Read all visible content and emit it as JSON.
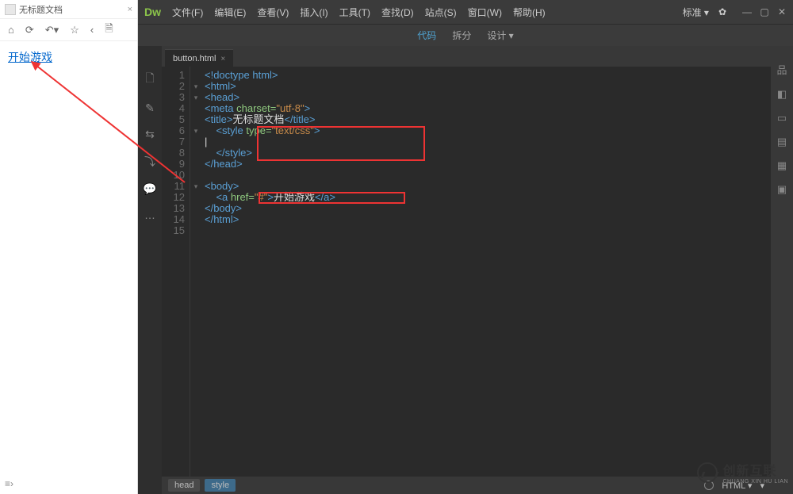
{
  "preview": {
    "title": "无标题文档",
    "close": "×",
    "toolbar": {
      "home": "⌂",
      "reload": "⟳",
      "back": "↶▾",
      "star": "☆",
      "left": "‹",
      "doc": "🗎"
    },
    "link_text": "开始游戏"
  },
  "dw": {
    "logo": "Dw",
    "menu": [
      "文件(F)",
      "编辑(E)",
      "查看(V)",
      "插入(I)",
      "工具(T)",
      "查找(D)",
      "站点(S)",
      "窗口(W)",
      "帮助(H)"
    ],
    "layout_label": "标准 ▾",
    "gear": "✿",
    "win": {
      "min": "—",
      "max": "▢",
      "close": "✕"
    },
    "views": {
      "code": "代码",
      "split": "拆分",
      "design": "设计 ▾"
    },
    "tab": {
      "name": "button.html",
      "close": "×"
    },
    "left_icons": [
      "🗋",
      "✎",
      "⇆",
      "⤵",
      "💬",
      "…"
    ],
    "right_icons": [
      "品",
      "◧",
      "▭",
      "▤",
      "▦",
      "▣"
    ],
    "lines": [
      "1",
      "2",
      "3",
      "4",
      "5",
      "6",
      "7",
      "8",
      "9",
      "10",
      "11",
      "12",
      "13",
      "14",
      "15"
    ],
    "folds": [
      "",
      "▾",
      "▾",
      "",
      "",
      "▾",
      "",
      "",
      "",
      "",
      "▾",
      "",
      "",
      "",
      ""
    ],
    "code": {
      "l1a": "<!doctype html>",
      "l2a": "<html>",
      "l3a": "<head>",
      "l4a": "<meta ",
      "l4b": "charset=",
      "l4c": "\"utf-8\"",
      "l4d": ">",
      "l5a": "<title>",
      "l5b": "无标题文档",
      "l5c": "</title>",
      "l6a": "<style ",
      "l6b": "type=",
      "l6c": "\"text/css\"",
      "l6d": ">",
      "l7": "|",
      "l8a": "</style>",
      "l9a": "</head>",
      "l11a": "<body>",
      "l12a": "<a ",
      "l12b": "href=",
      "l12c": "\"#\"",
      "l12d": ">",
      "l12e": "开始游戏",
      "l12f": "</a>",
      "l13a": "</body>",
      "l14a": "</html>"
    },
    "status": {
      "c1": "head",
      "c2": "style",
      "html": "HTML ▾",
      "ins": "▾"
    }
  },
  "watermark": {
    "big": "创新互联",
    "small": "CHUANG XIN HU LIAN"
  }
}
